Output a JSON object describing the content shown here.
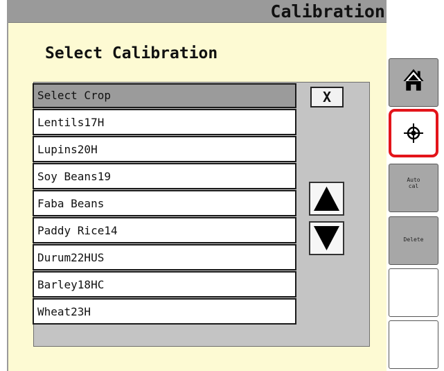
{
  "window": {
    "title": "Calibration"
  },
  "page": {
    "heading": "Select Calibration"
  },
  "crop_list": {
    "header": "Select Crop",
    "items": [
      {
        "label": "Lentils17H"
      },
      {
        "label": "Lupins20H"
      },
      {
        "label": "Soy Beans19"
      },
      {
        "label": "Faba Beans"
      },
      {
        "label": "Paddy Rice14"
      },
      {
        "label": "Durum22HUS"
      },
      {
        "label": "Barley18HC"
      },
      {
        "label": "Wheat23H"
      }
    ],
    "close_label": "X"
  },
  "scroll": {
    "up_icon": "triangle-up-icon",
    "down_icon": "triangle-down-icon"
  },
  "softkeys": {
    "home": {
      "icon": "home-icon"
    },
    "target": {
      "icon": "crosshair-icon",
      "selected": true,
      "highlight_color": "#e3141a"
    },
    "auto_cal": {
      "label": "Auto\ncal"
    },
    "delete": {
      "label": "Delete"
    }
  },
  "colors": {
    "panel_background": "#fdfad3",
    "title_bar": "#9a9a9a",
    "list_frame": "#c4c4c4",
    "softkey_gray": "#a7a7a7"
  }
}
